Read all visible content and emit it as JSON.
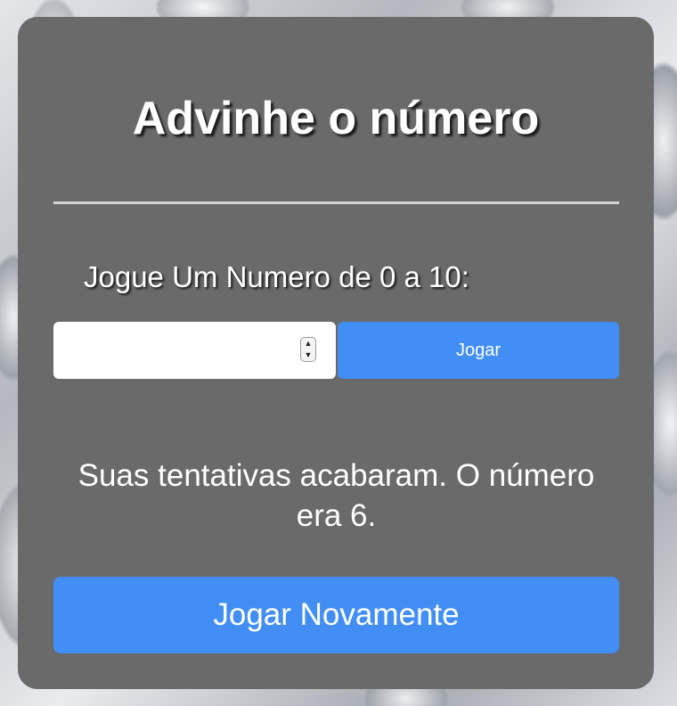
{
  "game": {
    "title": "Advinhe o número",
    "prompt": "Jogue Um Numero de 0 a 10:",
    "guess_input": {
      "value": "",
      "placeholder": ""
    },
    "play_button_label": "Jogar",
    "message": "Suas tentativas acabaram. O número era 6.",
    "replay_button_label": "Jogar Novamente"
  },
  "colors": {
    "card_background": "#6a6a6a",
    "accent_button": "#428ef4",
    "text": "#ffffff"
  },
  "icons": {
    "spinner_up": "chevron-up-icon",
    "spinner_down": "chevron-down-icon"
  }
}
